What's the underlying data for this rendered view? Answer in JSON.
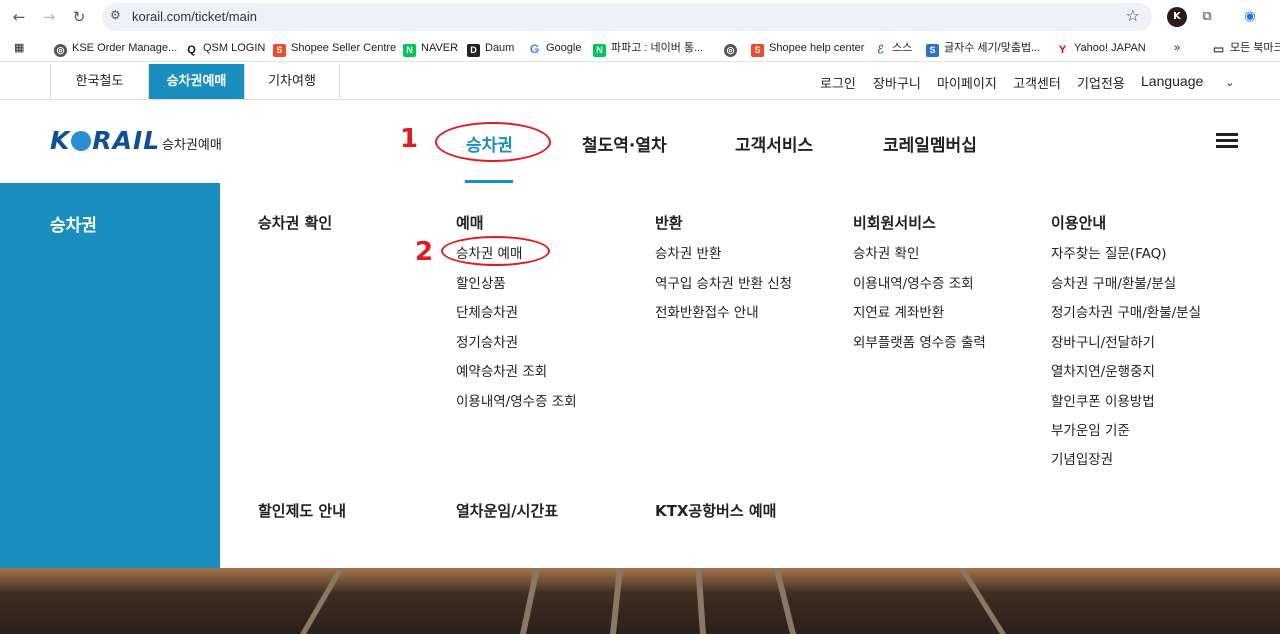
{
  "browser": {
    "url": "korail.com/ticket/main",
    "bookmarks": [
      {
        "label": "KSE Order Manage...",
        "icon": "globe-icon",
        "color": "#555555"
      },
      {
        "label": "QSM LOGIN",
        "icon": "q-icon",
        "color": "#111111"
      },
      {
        "label": "Shopee Seller Centre",
        "icon": "shopee-icon",
        "color": "#ee4d2d"
      },
      {
        "label": "NAVER",
        "icon": "naver-icon",
        "color": "#03c75a"
      },
      {
        "label": "Daum",
        "icon": "daum-icon",
        "color": "#222222"
      },
      {
        "label": "Google",
        "icon": "google-icon",
        "color": "#4285f4"
      },
      {
        "label": "파파고 : 네이버 통...",
        "icon": "naver-icon",
        "color": "#03c75a"
      },
      {
        "label": "",
        "icon": "globe-icon",
        "color": "#555555"
      },
      {
        "label": "Shopee help center",
        "icon": "shopee-icon",
        "color": "#ee4d2d"
      },
      {
        "label": "스스",
        "icon": "edge-icon",
        "color": "#2a6fd6"
      },
      {
        "label": "글자수 세기/맞춤법...",
        "icon": "s-icon",
        "color": "#2a6fd6"
      },
      {
        "label": "Yahoo! JAPAN",
        "icon": "yahoo-icon",
        "color": "#d6002a"
      },
      {
        "label": "모든 북마크",
        "icon": "folder-icon",
        "color": "#444444"
      }
    ]
  },
  "util": {
    "tabs": [
      "한국철도",
      "승차권예매",
      "기차여행"
    ],
    "links": [
      "로그인",
      "장바구니",
      "마이페이지",
      "고객센터",
      "기업전용",
      "Language"
    ]
  },
  "header": {
    "logo_text": "K RAIL",
    "logo_sub": "승차권예매",
    "nav": [
      "승차권",
      "철도역·열차",
      "고객서비스",
      "코레일멤버십"
    ],
    "annotation_1": "1",
    "annotation_2": "2"
  },
  "mega": {
    "side_title": "승차권",
    "columns": [
      {
        "head": "승차권 확인",
        "items": []
      },
      {
        "head": "예매",
        "items": [
          "승차권 예매",
          "할인상품",
          "단체승차권",
          "정기승차권",
          "예약승차권 조회",
          "이용내역/영수증 조회"
        ]
      },
      {
        "head": "반환",
        "items": [
          "승차권 반환",
          "역구입 승차권 반환 신청",
          "전화반환접수 안내"
        ]
      },
      {
        "head": "비회원서비스",
        "items": [
          "승차권 확인",
          "이용내역/영수증 조회",
          "지연료 계좌반환",
          "외부플랫폼 영수증 출력"
        ]
      },
      {
        "head": "이용안내",
        "items": [
          "자주찾는 질문(FAQ)",
          "승차권 구매/환불/분실",
          "정기승차권 구매/환불/분실",
          "장바구니/전달하기",
          "열차지연/운행중지",
          "할인쿠폰 이용방법",
          "부가운임 기준",
          "기념입장권"
        ]
      }
    ],
    "bottom_heads": [
      "할인제도 안내",
      "열차운임/시간표",
      "KTX공항버스 예매"
    ]
  }
}
